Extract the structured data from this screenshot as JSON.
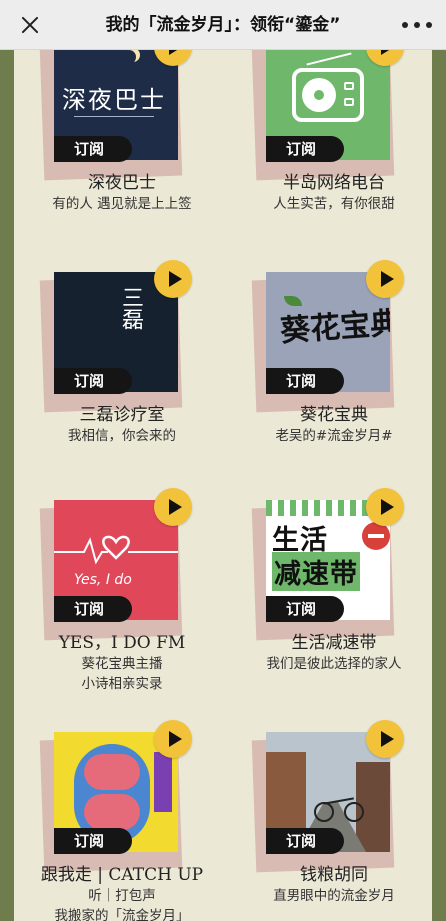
{
  "header": {
    "title": "我的「流金岁月」：领衔“鎏金”"
  },
  "subscribe_label": "订阅",
  "cards": [
    {
      "title": "深夜巴士",
      "desc": [
        "有的人 遇见就是上上签"
      ],
      "cover_text": "深夜巴士"
    },
    {
      "title": "半岛网络电台",
      "desc": [
        "人生实苦，有你很甜"
      ],
      "cover_text": ""
    },
    {
      "title": "三磊诊疗室",
      "desc": [
        "我相信，你会来的"
      ],
      "cover_text": "三磊"
    },
    {
      "title": "葵花宝典",
      "desc": [
        "老吴的#流金岁月#"
      ],
      "cover_text": "葵花宝典"
    },
    {
      "title": "YES，I DO FM",
      "desc": [
        "葵花宝典主播",
        "小诗相亲实录"
      ],
      "cover_text": "Yes, I do"
    },
    {
      "title": "生活减速带",
      "desc": [
        "我们是彼此选择的家人"
      ],
      "cover_text": [
        "生活",
        "减速带"
      ]
    },
    {
      "title": "跟我走 | CATCH UP",
      "desc": [
        "听｜打包声",
        "我搬家的「流金岁月」"
      ],
      "cover_text": ""
    },
    {
      "title": "钱粮胡同",
      "desc": [
        "直男眼中的流金岁月"
      ],
      "cover_text": ""
    }
  ],
  "colors": {
    "play_button": "#f2c23a",
    "subscribe_badge": "#151515",
    "background": "#ece8d6"
  }
}
